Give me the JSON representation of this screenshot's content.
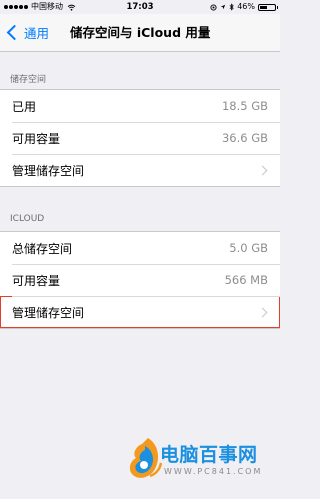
{
  "status_bar": {
    "carrier": "中国移动",
    "time": "17:03",
    "battery": "46%"
  },
  "nav": {
    "back_label": "通用",
    "title": "储存空间与 iCloud 用量"
  },
  "storage_section": {
    "header": "储存空间",
    "rows": [
      {
        "label": "已用",
        "value": "18.5 GB"
      },
      {
        "label": "可用容量",
        "value": "36.6 GB"
      },
      {
        "label": "管理储存空间"
      }
    ]
  },
  "icloud_section": {
    "header": "ICLOUD",
    "rows": [
      {
        "label": "总储存空间",
        "value": "5.0 GB"
      },
      {
        "label": "可用容量",
        "value": "566 MB"
      },
      {
        "label": "管理储存空间"
      }
    ]
  },
  "watermark": {
    "brand": "电脑百事网",
    "url": "WWW.PC841.COM"
  },
  "colors": {
    "accent": "#007aff",
    "highlight_border": "#e0402a",
    "watermark_blue": "#1b8fe0",
    "background": "#efeff4"
  }
}
